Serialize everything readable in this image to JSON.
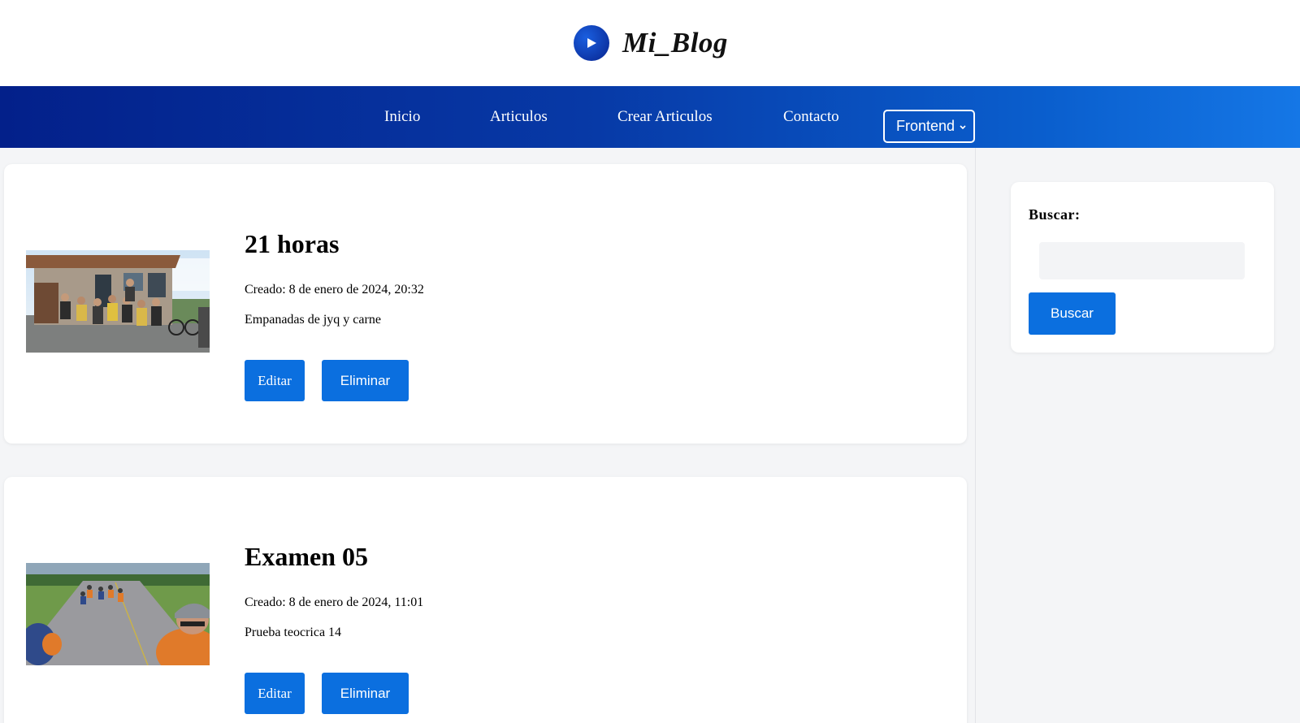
{
  "header": {
    "logo_text": "Mi_Blog"
  },
  "nav": {
    "links": [
      "Inicio",
      "Articulos",
      "Crear Articulos",
      "Contacto"
    ],
    "dropdown_value": "Frontend"
  },
  "posts": [
    {
      "title": "21 horas",
      "created": "Creado: 8 de enero de 2024, 20:32",
      "description": "Empanadas de jyq y carne",
      "edit_label": "Editar",
      "delete_label": "Eliminar"
    },
    {
      "title": "Examen 05",
      "created": "Creado: 8 de enero de 2024, 11:01",
      "description": "Prueba teocrica 14",
      "edit_label": "Editar",
      "delete_label": "Eliminar"
    }
  ],
  "sidebar": {
    "search_label": "Buscar:",
    "search_value": "",
    "search_button": "Buscar"
  },
  "colors": {
    "nav_gradient_start": "#03208a",
    "nav_gradient_end": "#1577e6",
    "button": "#0b6fdf"
  }
}
